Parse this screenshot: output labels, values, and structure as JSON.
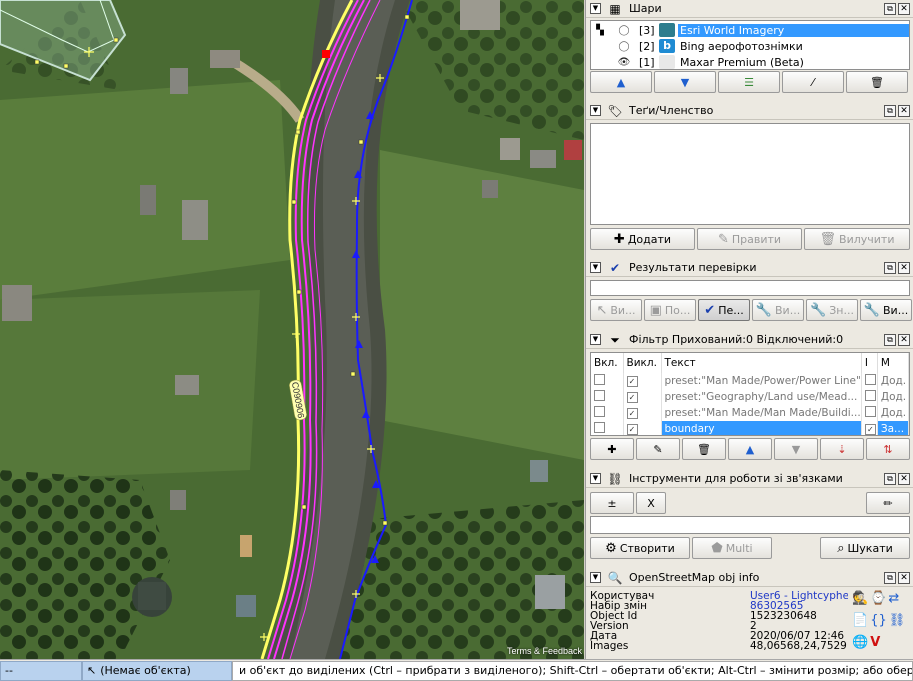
{
  "map": {
    "road_ref": "C090906",
    "attribution": "Terms & Feedback"
  },
  "layers_panel": {
    "title": "Шари",
    "layers": [
      {
        "index": "[3]",
        "name": "Esri World Imagery",
        "active": true,
        "visible": false
      },
      {
        "index": "[2]",
        "name": "Bing аерофотознімки",
        "active": false,
        "visible": false
      },
      {
        "index": "[1]",
        "name": "Maxar Premium (Beta)",
        "active": false,
        "visible": true
      }
    ]
  },
  "tags_panel": {
    "title": "Теґи/Членство",
    "add_label": "Додати",
    "edit_label": "Правити",
    "delete_label": "Вилучити"
  },
  "validation_panel": {
    "title": "Результати перевірки",
    "buttons": [
      "Ви...",
      "По...",
      "Пе...",
      "Ви...",
      "Зн...",
      "Ви..."
    ]
  },
  "filter_panel": {
    "title": "Фільтр Прихований:0 Відключений:0",
    "columns": [
      "Вкл.",
      "Викл.",
      "Текст",
      "I",
      "M"
    ],
    "rows": [
      {
        "text": "preset:\"Man Made/Power/Power Line\"",
        "mode": "Дод.",
        "highlight": false
      },
      {
        "text": "preset:\"Geography/Land use/Mead...",
        "mode": "Дод.",
        "highlight": false
      },
      {
        "text": "preset:\"Man Made/Man Made/Buildi...",
        "mode": "Дод.",
        "highlight": false
      },
      {
        "text": "boundary",
        "mode": "За...",
        "highlight": true
      }
    ]
  },
  "relation_panel": {
    "title": "Інструменти для роботи зі зв'язками",
    "create_label": "Створити",
    "multi_label": "Multi",
    "search_label": "Шукати",
    "x_label": "X"
  },
  "osm_info_panel": {
    "title": "OpenStreetMap obj info",
    "rows": [
      {
        "key": "Користувач",
        "value": "User6 - Lightcyphers",
        "link": true
      },
      {
        "key": "Набір змін",
        "value": "86302565",
        "link": true
      },
      {
        "key": "Object Id",
        "value": "1523230648",
        "link": false
      },
      {
        "key": "Version",
        "value": "2",
        "link": false
      },
      {
        "key": "Дата",
        "value": "2020/06/07 12:46 PM",
        "link": false
      },
      {
        "key": "Images",
        "value": "48,06568,24,75291",
        "link": false
      }
    ]
  },
  "status": {
    "coords": "--",
    "object": "(Немає об'єкта)",
    "hint": "и об'єкт до виділених (Ctrl – прибрати з виділеного); Shift-Ctrl – обертати об'єкти; Alt-Ctrl – змінити розмір; або оберіть інший об'єкт"
  },
  "colors": {
    "selection": "#3399ff",
    "road": "#ffff66",
    "boundary": "#ff33ff",
    "river": "#1a1aff",
    "link": "#1f38c6"
  }
}
